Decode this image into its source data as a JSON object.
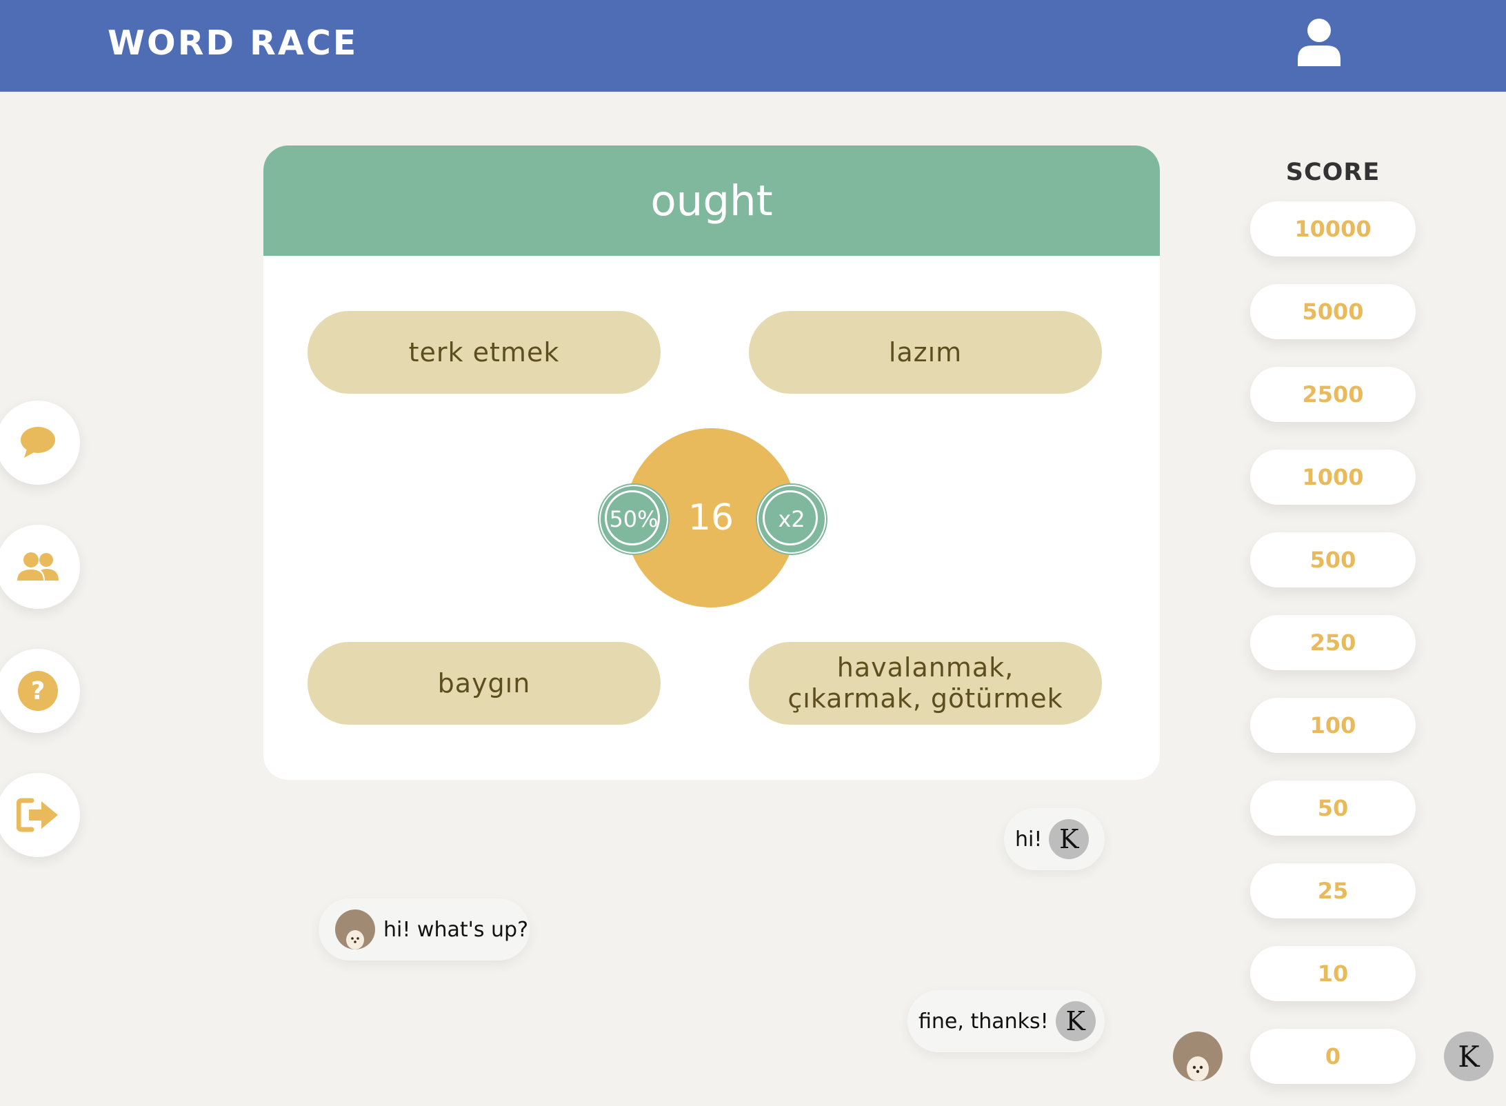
{
  "header": {
    "title": "WORD RACE",
    "user_icon": "user-icon"
  },
  "sidebar": {
    "items": [
      {
        "name": "chat",
        "icon": "chat-bubble-icon"
      },
      {
        "name": "friends",
        "icon": "users-icon"
      },
      {
        "name": "help",
        "icon": "question-icon"
      },
      {
        "name": "logout",
        "icon": "sign-out-icon"
      }
    ]
  },
  "question": {
    "word": "ought",
    "answers": [
      "terk etmek",
      "lazım",
      "baygın",
      "havalanmak, çıkarmak, götürmek"
    ],
    "timer": "16",
    "jokers": {
      "fifty": "50%",
      "double": "x2"
    }
  },
  "chat": {
    "messages": [
      {
        "text": "hi!",
        "sender": "K"
      },
      {
        "text": "hi! what's up?",
        "sender": "avatar"
      },
      {
        "text": "fine, thanks!",
        "sender": "K"
      }
    ]
  },
  "score": {
    "title": "SCORE",
    "levels": [
      "10000",
      "5000",
      "2500",
      "1000",
      "500",
      "250",
      "100",
      "50",
      "25",
      "10",
      "0"
    ],
    "opponent_initial": "K"
  },
  "colors": {
    "header": "#4f6db4",
    "card_head": "#80b89e",
    "answer": "#e5daaf",
    "accent": "#e9ba5b"
  }
}
